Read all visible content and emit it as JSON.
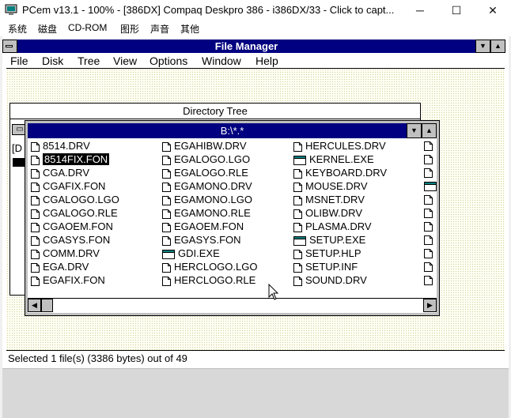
{
  "host": {
    "title": "PCem v13.1 - 100% - [386DX] Compaq Deskpro 386 - i386DX/33 - Click to capt...",
    "controls": {
      "minimize": "─",
      "maximize": "☐",
      "close": "✕"
    },
    "menu": [
      "系统",
      "磁盘",
      "CD-ROM",
      "图形",
      "声音",
      "其他"
    ]
  },
  "fm": {
    "title": "File Manager",
    "menu": [
      "File",
      "Disk",
      "Tree",
      "View",
      "Options",
      "Window",
      "Help"
    ],
    "tree_title": "Directory Tree",
    "tree_partial": "[D",
    "dir_title": "B:\\*.*",
    "columns": [
      [
        "8514.DRV",
        "8514FIX.FON",
        "CGA.DRV",
        "CGAFIX.FON",
        "CGALOGO.LGO",
        "CGALOGO.RLE",
        "CGAOEM.FON",
        "CGASYS.FON",
        "COMM.DRV",
        "EGA.DRV",
        "EGAFIX.FON"
      ],
      [
        "EGAHIBW.DRV",
        "EGALOGO.LGO",
        "EGALOGO.RLE",
        "EGAMONO.DRV",
        "EGAMONO.LGO",
        "EGAMONO.RLE",
        "EGAOEM.FON",
        "EGASYS.FON",
        "GDI.EXE",
        "HERCLOGO.LGO",
        "HERCLOGO.RLE"
      ],
      [
        "HERCULES.DRV",
        "KERNEL.EXE",
        "KEYBOARD.DRV",
        "MOUSE.DRV",
        "MSNET.DRV",
        "OLIBW.DRV",
        "PLASMA.DRV",
        "SETUP.EXE",
        "SETUP.HLP",
        "SETUP.INF",
        "SOUND.DRV"
      ]
    ],
    "exe_files": [
      "GDI.EXE",
      "KERNEL.EXE",
      "SETUP.EXE"
    ],
    "selected_file": "8514FIX.FON",
    "status": "Selected 1 file(s) (3386 bytes) out of 49"
  }
}
